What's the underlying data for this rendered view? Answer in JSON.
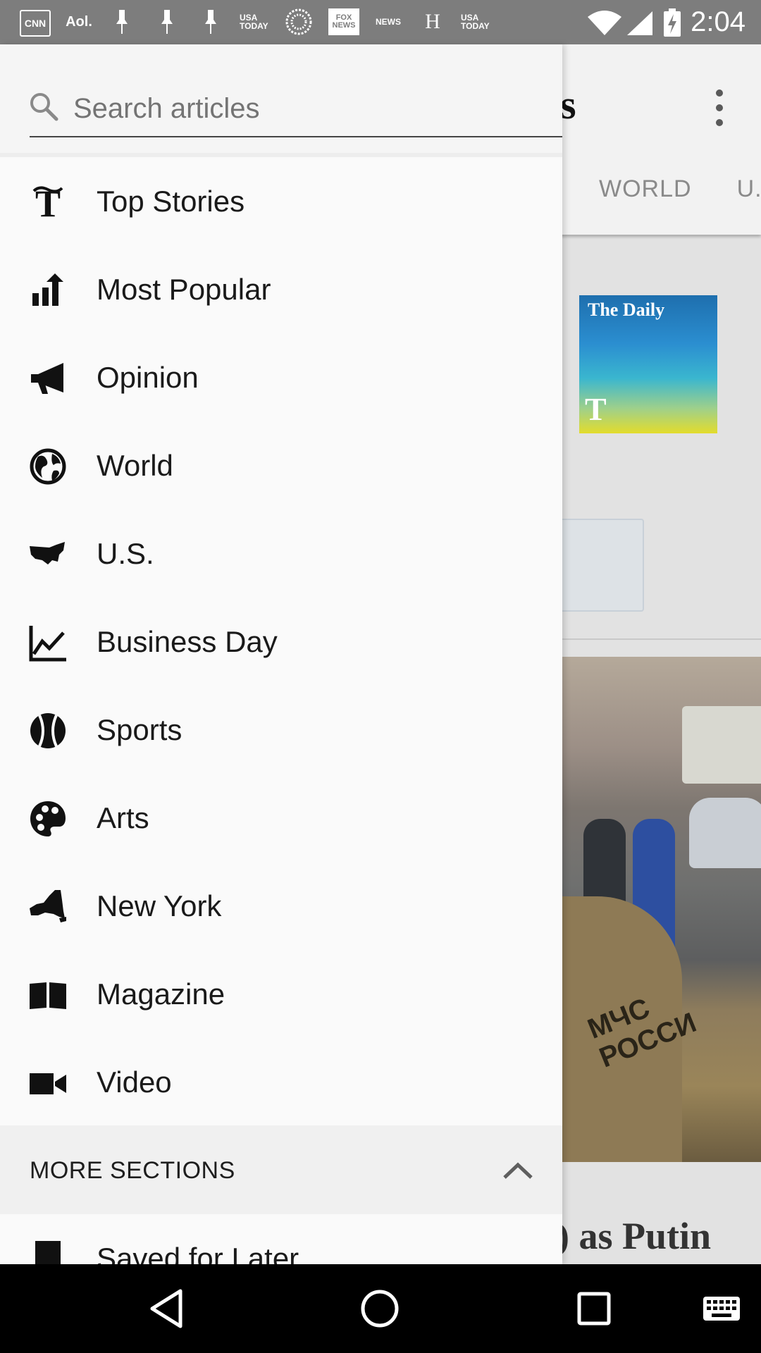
{
  "status_bar": {
    "time": "2:04",
    "notifications": [
      "CNN",
      "Aol.",
      "USA TODAY",
      "FOX NEWS",
      "NEWS",
      "H",
      "USA TODAY"
    ]
  },
  "search": {
    "placeholder": "Search articles",
    "value": ""
  },
  "drawer": {
    "items": [
      {
        "label": "Top Stories",
        "icon": "nyt-t-icon"
      },
      {
        "label": "Most Popular",
        "icon": "trending-icon"
      },
      {
        "label": "Opinion",
        "icon": "megaphone-icon"
      },
      {
        "label": "World",
        "icon": "globe-icon"
      },
      {
        "label": "U.S.",
        "icon": "us-map-icon"
      },
      {
        "label": "Business Day",
        "icon": "chart-line-icon"
      },
      {
        "label": "Sports",
        "icon": "baseball-icon"
      },
      {
        "label": "Arts",
        "icon": "palette-icon"
      },
      {
        "label": "New York",
        "icon": "new-york-map-icon"
      },
      {
        "label": "Magazine",
        "icon": "book-open-icon"
      },
      {
        "label": "Video",
        "icon": "video-camera-icon"
      }
    ],
    "more_sections": {
      "label": "MORE SECTIONS",
      "expanded": true
    },
    "saved": {
      "label": "Saved for Later",
      "icon": "bookmark-icon"
    }
  },
  "background_app": {
    "logo_fragment": "s",
    "tabs": [
      "WORLD",
      "U.S."
    ],
    "podcast_card": {
      "title": "The Daily",
      "logo": "T"
    },
    "photo_caption": "МЧС\nРОССИ",
    "headline_fragment": ") as Putin"
  },
  "colors": {
    "status_bar": "#7d7d7d",
    "drawer_background": "#fafafa",
    "more_sections_background": "#f0f0f0",
    "nav_bar": "#000000"
  }
}
